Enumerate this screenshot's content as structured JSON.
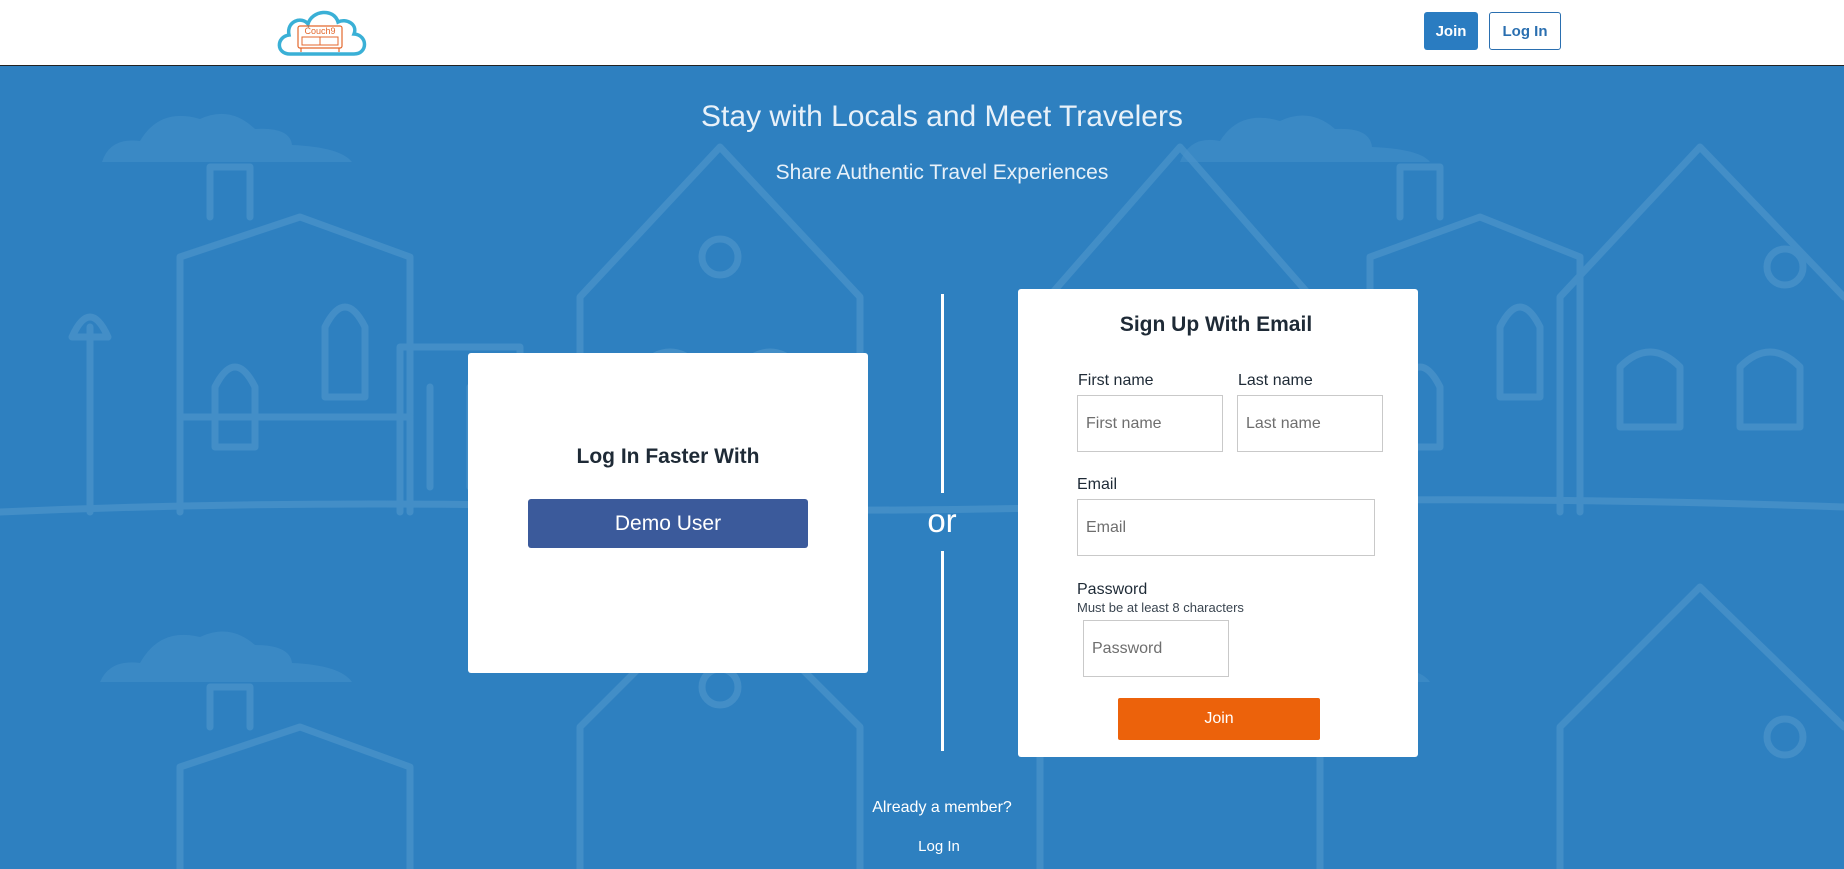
{
  "header": {
    "logo_text": "Couch9",
    "join_label": "Join",
    "login_label": "Log In"
  },
  "hero": {
    "title": "Stay with Locals and Meet Travelers",
    "subtitle": "Share Authentic Travel Experiences"
  },
  "demo_card": {
    "title": "Log In Faster With",
    "demo_button": "Demo User"
  },
  "divider": {
    "or_text": "or"
  },
  "signup": {
    "title": "Sign Up With Email",
    "first_name_label": "First name",
    "first_name_placeholder": "First name",
    "last_name_label": "Last name",
    "last_name_placeholder": "Last name",
    "email_label": "Email",
    "email_placeholder": "Email",
    "password_label": "Password",
    "password_hint": "Must be at least 8 characters",
    "password_placeholder": "Password",
    "join_button": "Join"
  },
  "footer": {
    "already_member": "Already a member?",
    "login_link": "Log In"
  },
  "colors": {
    "background": "#2e80c0",
    "primary": "#2a7cc1",
    "demo_button": "#3b5a9b",
    "join_button": "#ec620b",
    "logo": "#3ab0d6"
  }
}
